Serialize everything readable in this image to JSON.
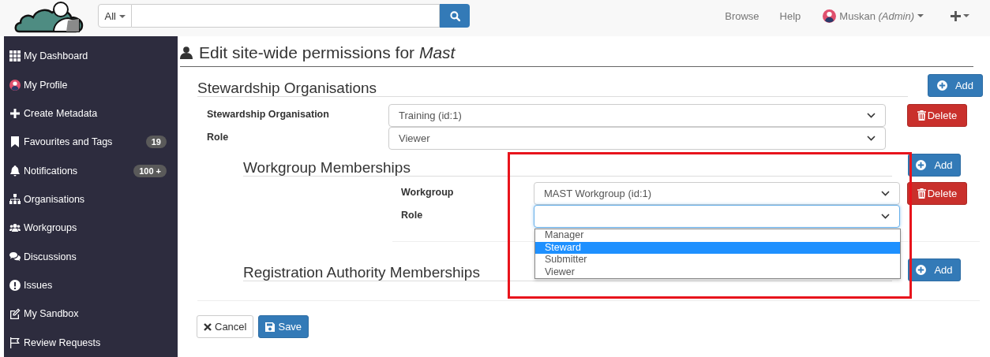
{
  "topbar": {
    "search_scope": "All",
    "nav": [
      "Browse",
      "Help"
    ],
    "user": {
      "name": "Muskan",
      "role": "(Admin)"
    }
  },
  "sidebar": {
    "items": [
      {
        "label": "My Dashboard"
      },
      {
        "label": "My Profile"
      },
      {
        "label": "Create Metadata"
      },
      {
        "label": "Favourites and Tags",
        "badge": "19"
      },
      {
        "label": "Notifications",
        "badge": "100 +"
      },
      {
        "label": "Organisations"
      },
      {
        "label": "Workgroups"
      },
      {
        "label": "Discussions"
      },
      {
        "label": "Issues"
      },
      {
        "label": "My Sandbox"
      },
      {
        "label": "Review Requests"
      }
    ]
  },
  "page": {
    "title": "Edit site-wide permissions for *Mast*"
  },
  "stewardship": {
    "heading": "Stewardship Organisations",
    "add": "Add",
    "delete": "Delete",
    "fields": [
      {
        "label": "Stewardship Organisation",
        "value": "Training (id:1)"
      },
      {
        "label": "Role",
        "value": "Viewer"
      }
    ]
  },
  "workgroups": {
    "heading": "Workgroup Memberships",
    "add": "Add",
    "delete": "Delete",
    "fields": [
      {
        "label": "Workgroup",
        "value": "MAST Workgroup (id:1)",
        "focused": false
      },
      {
        "label": "Role",
        "focused": true,
        "expanded": true,
        "options": [
          {
            "label": "Manager",
            "selected": false
          },
          {
            "label": "Steward",
            "selected": true
          },
          {
            "label": "Submitter",
            "selected": false
          },
          {
            "label": "Viewer",
            "selected": false
          }
        ]
      }
    ]
  },
  "registration": {
    "heading": "Registration Authority Memberships",
    "add": "Add"
  },
  "actions": {
    "cancel": "Cancel",
    "save": "Save"
  },
  "highlight_box": true
}
